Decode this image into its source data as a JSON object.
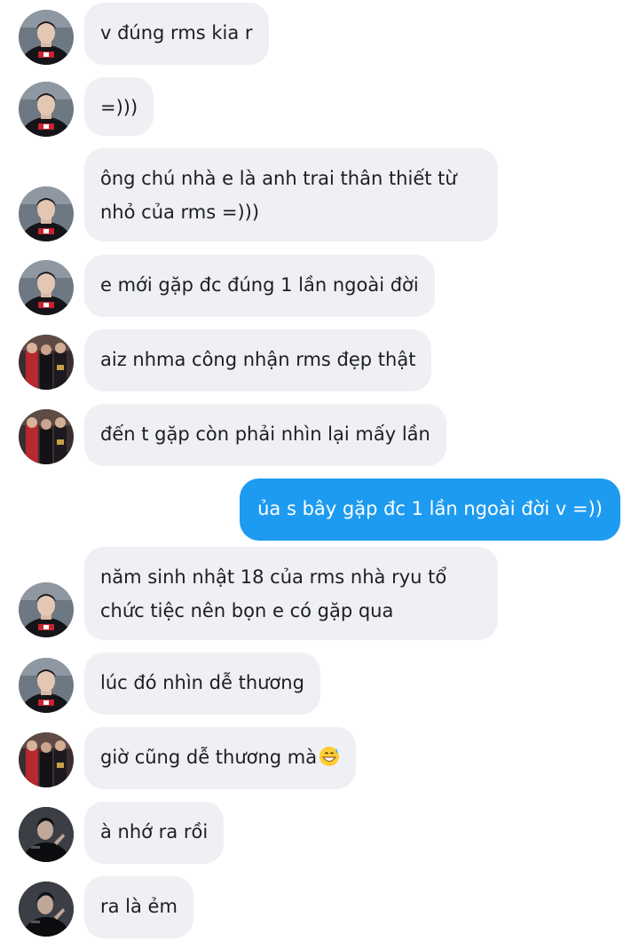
{
  "messages": [
    {
      "id": "m1",
      "direction": "incoming",
      "sender": "user-a",
      "lines": [
        "v đúng rms kia r"
      ],
      "show_avatar": true
    },
    {
      "id": "m2",
      "direction": "incoming",
      "sender": "user-a",
      "lines": [
        "=)))"
      ],
      "show_avatar": true
    },
    {
      "id": "m3",
      "direction": "incoming",
      "sender": "user-a",
      "lines": [
        "ông chú nhà e là anh trai thân thiết từ",
        "nhỏ của rms =)))"
      ],
      "show_avatar": true
    },
    {
      "id": "m4",
      "direction": "incoming",
      "sender": "user-a",
      "lines": [
        "e mới gặp đc đúng 1 lần ngoài đời"
      ],
      "show_avatar": true
    },
    {
      "id": "m5",
      "direction": "incoming",
      "sender": "user-b",
      "lines": [
        "aiz nhma công nhận rms đẹp thật"
      ],
      "show_avatar": true
    },
    {
      "id": "m6",
      "direction": "incoming",
      "sender": "user-b",
      "lines": [
        "đến t gặp còn phải nhìn lại mấy lần"
      ],
      "show_avatar": true
    },
    {
      "id": "m7",
      "direction": "outgoing",
      "sender": "me",
      "lines": [
        "ủa s bây gặp đc 1 lần ngoài đời v =))"
      ],
      "show_avatar": false
    },
    {
      "id": "m8",
      "direction": "incoming",
      "sender": "user-a",
      "lines": [
        "năm sinh nhật 18 của rms nhà ryu tổ",
        "chức tiệc nên bọn e có gặp qua"
      ],
      "show_avatar": true
    },
    {
      "id": "m9",
      "direction": "incoming",
      "sender": "user-a",
      "lines": [
        "lúc đó nhìn dễ thương"
      ],
      "show_avatar": true
    },
    {
      "id": "m10",
      "direction": "incoming",
      "sender": "user-b",
      "lines": [
        "giờ cũng dễ thương mà"
      ],
      "emoji": "grinning-sweat-emoji",
      "show_avatar": true
    },
    {
      "id": "m11",
      "direction": "incoming",
      "sender": "user-c",
      "lines": [
        "à nhớ ra rồi"
      ],
      "show_avatar": true
    },
    {
      "id": "m12",
      "direction": "incoming",
      "sender": "user-c",
      "lines": [
        "ra là ẻm"
      ],
      "show_avatar": true
    }
  ],
  "colors": {
    "incoming_bubble": "#eef0f4",
    "outgoing_bubble": "#1d9bf0",
    "incoming_text": "#1c1e21",
    "outgoing_text": "#ffffff",
    "background": "#ffffff"
  },
  "icons": {
    "user-a": "avatar-player-red-jersey-icon",
    "user-b": "avatar-group-photo-icon",
    "user-c": "avatar-dark-portrait-icon"
  }
}
